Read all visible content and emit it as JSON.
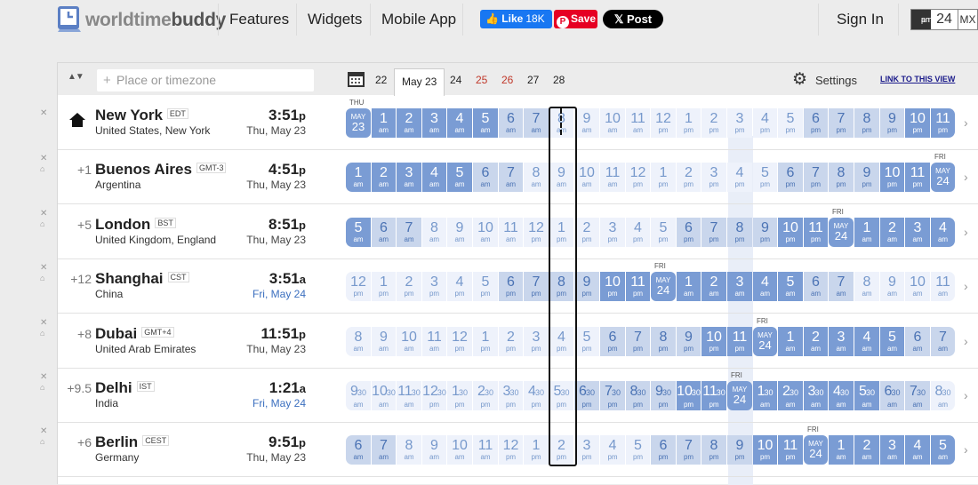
{
  "brand": {
    "logo_light": "worldtime",
    "logo_dark": "buddy"
  },
  "nav": [
    "Features",
    "Widgets",
    "Mobile App"
  ],
  "social": {
    "like_label": "Like",
    "like_count": "18K",
    "save_label": "Save",
    "post_label": "Post"
  },
  "auth": {
    "sign_in": "Sign In"
  },
  "format_toggle": {
    "ampm_line1": "am",
    "ampm_line2": "pm",
    "h24": "24",
    "mixed": "MX"
  },
  "toolbar": {
    "place_placeholder": "Place or timezone",
    "dates": [
      "22",
      "May 23",
      "24",
      "25",
      "26",
      "27",
      "28"
    ],
    "active_date": "May 23",
    "weekend_dates": [
      "25",
      "26"
    ],
    "settings_label": "Settings",
    "link_label": "LINK TO THIS VIEW"
  },
  "labels": {
    "thu": "THU",
    "fri": "FRI"
  },
  "rows": [
    {
      "offset": "",
      "home": true,
      "city": "New York",
      "abbr": "EDT",
      "country": "United States, New York",
      "time": "3:51",
      "suffix": "p",
      "date": "Thu, May 23",
      "date_blue": false,
      "day_marker": "THU",
      "day_label": [
        "MAY",
        "23"
      ],
      "day_index": 0
    },
    {
      "offset": "+1",
      "home": false,
      "city": "Buenos Aires",
      "abbr": "GMT-3",
      "country": "Argentina",
      "time": "4:51",
      "suffix": "p",
      "date": "Thu, May 23",
      "date_blue": false,
      "day_marker": "FRI",
      "day_label": [
        "MAY",
        "24"
      ],
      "day_index": 23
    },
    {
      "offset": "+5",
      "home": false,
      "city": "London",
      "abbr": "BST",
      "country": "United Kingdom, England",
      "time": "8:51",
      "suffix": "p",
      "date": "Thu, May 23",
      "date_blue": false,
      "day_marker": "FRI",
      "day_label": [
        "MAY",
        "24"
      ],
      "day_index": 19
    },
    {
      "offset": "+12",
      "home": false,
      "city": "Shanghai",
      "abbr": "CST",
      "country": "China",
      "time": "3:51",
      "suffix": "a",
      "date": "Fri, May 24",
      "date_blue": true,
      "day_marker": "FRI",
      "day_label": [
        "MAY",
        "24"
      ],
      "day_index": 12
    },
    {
      "offset": "+8",
      "home": false,
      "city": "Dubai",
      "abbr": "GMT+4",
      "country": "United Arab Emirates",
      "time": "11:51",
      "suffix": "p",
      "date": "Thu, May 23",
      "date_blue": false,
      "day_marker": "FRI",
      "day_label": [
        "MAY",
        "24"
      ],
      "day_index": 16
    },
    {
      "offset": "+9.5",
      "home": false,
      "city": "Delhi",
      "abbr": "IST",
      "country": "India",
      "time": "1:21",
      "suffix": "a",
      "date": "Fri, May 24",
      "date_blue": true,
      "day_marker": "FRI",
      "day_label": [
        "MAY",
        "24"
      ],
      "day_index": 15
    },
    {
      "offset": "+6",
      "home": false,
      "city": "Berlin",
      "abbr": "CEST",
      "country": "Germany",
      "time": "9:51",
      "suffix": "p",
      "date": "Thu, May 23",
      "date_blue": false,
      "day_marker": "FRI",
      "day_label": [
        "MAY",
        "24"
      ],
      "day_index": 18
    }
  ],
  "hours": [
    [
      [
        "MAY 23",
        ""
      ],
      [
        "1",
        "am"
      ],
      [
        "2",
        "am"
      ],
      [
        "3",
        "am"
      ],
      [
        "4",
        "am"
      ],
      [
        "5",
        "am"
      ],
      [
        "6",
        "am"
      ],
      [
        "7",
        "am"
      ],
      [
        "8",
        "am"
      ],
      [
        "9",
        "am"
      ],
      [
        "10",
        "am"
      ],
      [
        "11",
        "am"
      ],
      [
        "12",
        "pm"
      ],
      [
        "1",
        "pm"
      ],
      [
        "2",
        "pm"
      ],
      [
        "3",
        "pm"
      ],
      [
        "4",
        "pm"
      ],
      [
        "5",
        "pm"
      ],
      [
        "6",
        "pm"
      ],
      [
        "7",
        "pm"
      ],
      [
        "8",
        "pm"
      ],
      [
        "9",
        "pm"
      ],
      [
        "10",
        "pm"
      ],
      [
        "11",
        "pm"
      ]
    ],
    [
      [
        "1",
        "am"
      ],
      [
        "2",
        "am"
      ],
      [
        "3",
        "am"
      ],
      [
        "4",
        "am"
      ],
      [
        "5",
        "am"
      ],
      [
        "6",
        "am"
      ],
      [
        "7",
        "am"
      ],
      [
        "8",
        "am"
      ],
      [
        "9",
        "am"
      ],
      [
        "10",
        "am"
      ],
      [
        "11",
        "am"
      ],
      [
        "12",
        "pm"
      ],
      [
        "1",
        "pm"
      ],
      [
        "2",
        "pm"
      ],
      [
        "3",
        "pm"
      ],
      [
        "4",
        "pm"
      ],
      [
        "5",
        "pm"
      ],
      [
        "6",
        "pm"
      ],
      [
        "7",
        "pm"
      ],
      [
        "8",
        "pm"
      ],
      [
        "9",
        "pm"
      ],
      [
        "10",
        "pm"
      ],
      [
        "11",
        "pm"
      ],
      [
        "MAY 24",
        ""
      ]
    ],
    [
      [
        "5",
        "am"
      ],
      [
        "6",
        "am"
      ],
      [
        "7",
        "am"
      ],
      [
        "8",
        "am"
      ],
      [
        "9",
        "am"
      ],
      [
        "10",
        "am"
      ],
      [
        "11",
        "am"
      ],
      [
        "12",
        "pm"
      ],
      [
        "1",
        "pm"
      ],
      [
        "2",
        "pm"
      ],
      [
        "3",
        "pm"
      ],
      [
        "4",
        "pm"
      ],
      [
        "5",
        "pm"
      ],
      [
        "6",
        "pm"
      ],
      [
        "7",
        "pm"
      ],
      [
        "8",
        "pm"
      ],
      [
        "9",
        "pm"
      ],
      [
        "10",
        "pm"
      ],
      [
        "11",
        "pm"
      ],
      [
        "MAY 24",
        ""
      ],
      [
        "1",
        "am"
      ],
      [
        "2",
        "am"
      ],
      [
        "3",
        "am"
      ],
      [
        "4",
        "am"
      ]
    ],
    [
      [
        "12",
        "pm"
      ],
      [
        "1",
        "pm"
      ],
      [
        "2",
        "pm"
      ],
      [
        "3",
        "pm"
      ],
      [
        "4",
        "pm"
      ],
      [
        "5",
        "pm"
      ],
      [
        "6",
        "pm"
      ],
      [
        "7",
        "pm"
      ],
      [
        "8",
        "pm"
      ],
      [
        "9",
        "pm"
      ],
      [
        "10",
        "pm"
      ],
      [
        "11",
        "pm"
      ],
      [
        "MAY 24",
        ""
      ],
      [
        "1",
        "am"
      ],
      [
        "2",
        "am"
      ],
      [
        "3",
        "am"
      ],
      [
        "4",
        "am"
      ],
      [
        "5",
        "am"
      ],
      [
        "6",
        "am"
      ],
      [
        "7",
        "am"
      ],
      [
        "8",
        "am"
      ],
      [
        "9",
        "am"
      ],
      [
        "10",
        "am"
      ],
      [
        "11",
        "am"
      ]
    ],
    [
      [
        "8",
        "am"
      ],
      [
        "9",
        "am"
      ],
      [
        "10",
        "am"
      ],
      [
        "11",
        "am"
      ],
      [
        "12",
        "pm"
      ],
      [
        "1",
        "pm"
      ],
      [
        "2",
        "pm"
      ],
      [
        "3",
        "pm"
      ],
      [
        "4",
        "pm"
      ],
      [
        "5",
        "pm"
      ],
      [
        "6",
        "pm"
      ],
      [
        "7",
        "pm"
      ],
      [
        "8",
        "pm"
      ],
      [
        "9",
        "pm"
      ],
      [
        "10",
        "pm"
      ],
      [
        "11",
        "pm"
      ],
      [
        "MAY 24",
        ""
      ],
      [
        "1",
        "am"
      ],
      [
        "2",
        "am"
      ],
      [
        "3",
        "am"
      ],
      [
        "4",
        "am"
      ],
      [
        "5",
        "am"
      ],
      [
        "6",
        "am"
      ],
      [
        "7",
        "am"
      ]
    ],
    [
      [
        "9",
        "am",
        "30"
      ],
      [
        "10",
        "am",
        "30"
      ],
      [
        "11",
        "am",
        "30"
      ],
      [
        "12",
        "pm",
        "30"
      ],
      [
        "1",
        "pm",
        "30"
      ],
      [
        "2",
        "pm",
        "30"
      ],
      [
        "3",
        "pm",
        "30"
      ],
      [
        "4",
        "pm",
        "30"
      ],
      [
        "5",
        "pm",
        "30"
      ],
      [
        "6",
        "pm",
        "30"
      ],
      [
        "7",
        "pm",
        "30"
      ],
      [
        "8",
        "pm",
        "30"
      ],
      [
        "9",
        "pm",
        "30"
      ],
      [
        "10",
        "pm",
        "30"
      ],
      [
        "11",
        "pm",
        "30"
      ],
      [
        "MAY 24",
        ""
      ],
      [
        "1",
        "am",
        "30"
      ],
      [
        "2",
        "am",
        "30"
      ],
      [
        "3",
        "am",
        "30"
      ],
      [
        "4",
        "am",
        "30"
      ],
      [
        "5",
        "am",
        "30"
      ],
      [
        "6",
        "am",
        "30"
      ],
      [
        "7",
        "am",
        "30"
      ],
      [
        "8",
        "am",
        "30"
      ]
    ],
    [
      [
        "6",
        "am"
      ],
      [
        "7",
        "am"
      ],
      [
        "8",
        "am"
      ],
      [
        "9",
        "am"
      ],
      [
        "10",
        "am"
      ],
      [
        "11",
        "am"
      ],
      [
        "12",
        "pm"
      ],
      [
        "1",
        "pm"
      ],
      [
        "2",
        "pm"
      ],
      [
        "3",
        "pm"
      ],
      [
        "4",
        "pm"
      ],
      [
        "5",
        "pm"
      ],
      [
        "6",
        "pm"
      ],
      [
        "7",
        "pm"
      ],
      [
        "8",
        "pm"
      ],
      [
        "9",
        "pm"
      ],
      [
        "10",
        "pm"
      ],
      [
        "11",
        "pm"
      ],
      [
        "MAY 24",
        ""
      ],
      [
        "1",
        "am"
      ],
      [
        "2",
        "am"
      ],
      [
        "3",
        "am"
      ],
      [
        "4",
        "am"
      ],
      [
        "5",
        "am"
      ]
    ]
  ]
}
